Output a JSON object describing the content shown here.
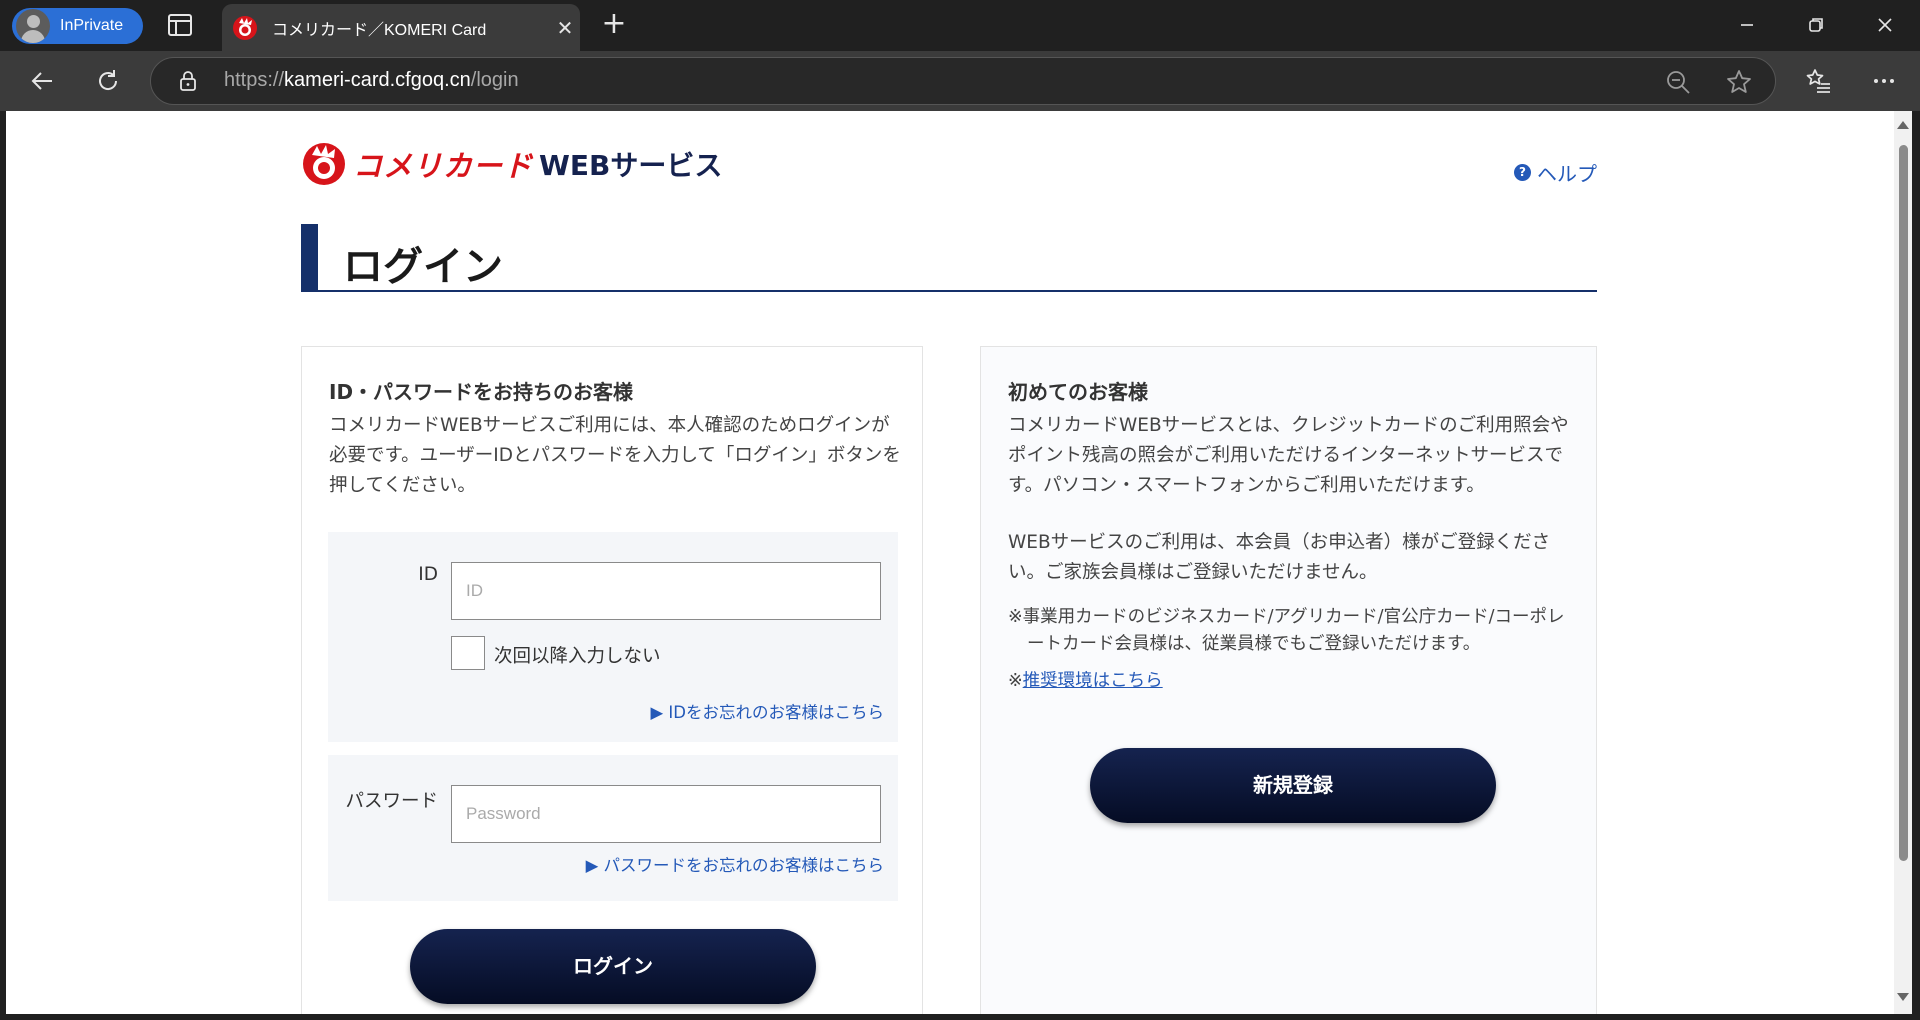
{
  "browser": {
    "inprivate_label": "InPrivate",
    "tab_title": "コメリカード／KOMERI Card",
    "url_scheme": "https://",
    "url_host": "kameri-card.cfgoq.cn",
    "url_path": "/login"
  },
  "header": {
    "logo_brand": "コメリカード",
    "logo_web": "WEBサービス",
    "help_label": "ヘルプ"
  },
  "page": {
    "title": "ログイン"
  },
  "login_panel": {
    "heading": "ID・パスワードをお持ちのお客様",
    "description": "コメリカードWEBサービスご利用には、本人確認のためログインが必要です。ユーザーIDとパスワードを入力して「ログイン」ボタンを押してください。",
    "id_label": "ID",
    "id_placeholder": "ID",
    "remember_label": "次回以降入力しない",
    "forgot_id_link": "▶ IDをお忘れのお客様はこちら",
    "password_label": "パスワード",
    "password_placeholder": "Password",
    "forgot_password_link": "▶ パスワードをお忘れのお客様はこちら",
    "login_button": "ログイン"
  },
  "new_panel": {
    "heading": "初めてのお客様",
    "description": "コメリカードWEBサービスとは、クレジットカードのご利用照会やポイント残高の照会がご利用いただけるインターネットサービスです。パソコン・スマートフォンからご利用いただけます。",
    "description2": "WEBサービスのご利用は、本会員（お申込者）様がご登録ください。ご家族会員様はご登録いただけません。",
    "note": "※事業用カードのビジネスカード/アグリカード/官公庁カード/コーポレートカード会員様は、従業員様でもご登録いただけます。",
    "note2_prefix": "※",
    "recommended_link": "推奨環境はこちら",
    "register_button": "新規登録"
  },
  "colors": {
    "brand_red": "#d7141a",
    "navy": "#15306a",
    "link_blue": "#2459b8"
  }
}
